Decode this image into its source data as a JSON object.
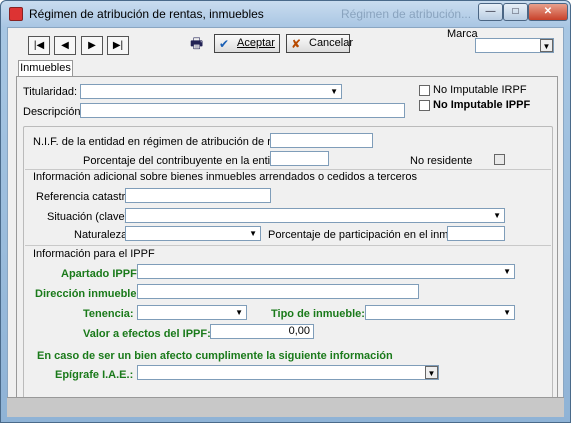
{
  "window": {
    "title": "Régimen de atribución de rentas, inmuebles",
    "ghost_title": "Régimen de atribución...",
    "min_glyph": "—",
    "max_glyph": "□",
    "close_glyph": "✕"
  },
  "toolbar": {
    "first_glyph": "|◀",
    "prev_glyph": "◀",
    "next_glyph": "▶",
    "last_glyph": "▶|",
    "print_glyph": "🖶",
    "accept_label": "Aceptar",
    "accept_icon": "✔",
    "cancel_label": "Cancelar",
    "cancel_icon": "✘",
    "marca_label": "Marca",
    "marca_value": ""
  },
  "tabs": [
    {
      "label": "Inmuebles"
    }
  ],
  "form": {
    "titularidad_label": "Titularidad:",
    "descripcion_label": "Descripción:",
    "no_imputable_irpf_label": "No Imputable IRPF",
    "no_imputable_ippf_label": "No Imputable IPPF",
    "nif_label": "N.I.F. de la entidad en régimen de atribución de rentas:",
    "porcentaje_label": "Porcentaje del contribuyente en la entidad:",
    "no_residente_label": "No residente",
    "info_adicional_label": "Información adicional sobre bienes inmuebles arrendados o cedidos a terceros",
    "referencia_label": "Referencia catastral:",
    "situacion_label": "Situación (clave):",
    "naturaleza_label": "Naturaleza:",
    "porcentaje_participacion_label": "Porcentaje de participación en el inmueble:",
    "info_ippf_label": "Información para el IPPF",
    "apartado_label": "Apartado IPPF:",
    "direccion_label": "Dirección inmueble:",
    "tenencia_label": "Tenencia:",
    "tipo_label": "Tipo de inmueble:",
    "valor_label": "Valor a efectos del IPPF:",
    "valor_value": "0,00",
    "afecto_label": "En caso de ser un bien afecto cumplimente la siguiente información",
    "epigrafe_label": "Epígrafe I.A.E.:"
  },
  "colors": {
    "green_label": "#1a7a1a",
    "field_border": "#7f9db9"
  }
}
